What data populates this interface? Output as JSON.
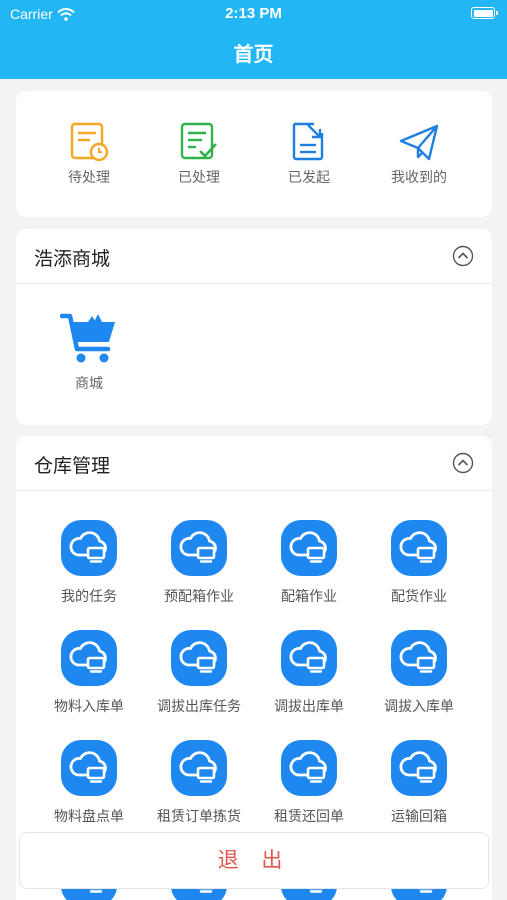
{
  "status": {
    "carrier": "Carrier",
    "time": "2:13 PM"
  },
  "nav": {
    "title": "首页"
  },
  "quick": [
    {
      "label": "待处理",
      "icon": "pending-doc-icon",
      "color": "#f5a623"
    },
    {
      "label": "已处理",
      "icon": "done-doc-icon",
      "color": "#2fb24c"
    },
    {
      "label": "已发起",
      "icon": "sent-doc-icon",
      "color": "#1f7fe0"
    },
    {
      "label": "我收到的",
      "icon": "paper-plane-icon",
      "color": "#1f7fe0"
    }
  ],
  "mall": {
    "title": "浩添商城",
    "items": [
      {
        "label": "商城",
        "icon": "shopping-cart-icon"
      }
    ]
  },
  "warehouse": {
    "title": "仓库管理",
    "items": [
      {
        "label": "我的任务"
      },
      {
        "label": "预配箱作业"
      },
      {
        "label": "配箱作业"
      },
      {
        "label": "配货作业"
      },
      {
        "label": "物料入库单"
      },
      {
        "label": "调拔出库任务"
      },
      {
        "label": "调拔出库单"
      },
      {
        "label": "调拔入库单"
      },
      {
        "label": "物料盘点单"
      },
      {
        "label": "租赁订单拣货"
      },
      {
        "label": "租赁还回单"
      },
      {
        "label": "运输回箱"
      },
      {
        "label": ""
      },
      {
        "label": ""
      },
      {
        "label": ""
      },
      {
        "label": ""
      }
    ]
  },
  "logout": {
    "label": "退 出"
  },
  "colors": {
    "nav": "#22b6f5",
    "app_icon": "#1e88f0",
    "logout_text": "#e0574c"
  }
}
